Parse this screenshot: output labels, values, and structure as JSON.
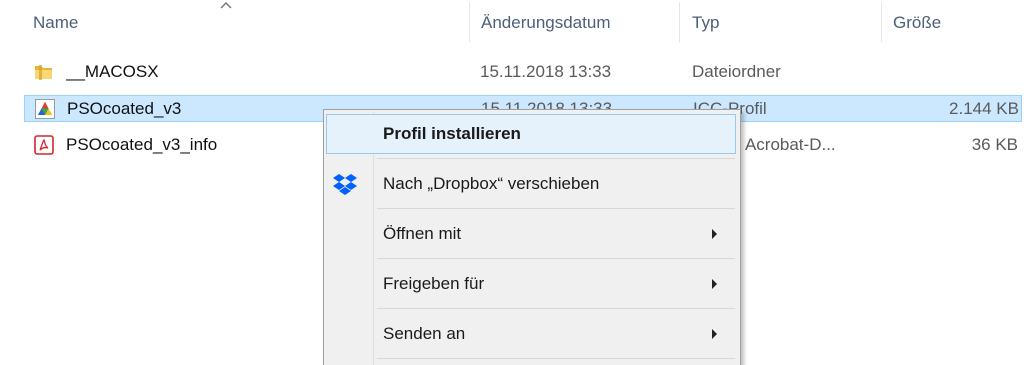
{
  "columns": {
    "name": "Name",
    "modified": "Änderungsdatum",
    "type": "Typ",
    "size": "Größe"
  },
  "files": [
    {
      "name": "__MACOSX",
      "modified": "15.11.2018 13:33",
      "type": "Dateiordner",
      "size": "",
      "icon": "folder-icon"
    },
    {
      "name": "PSOcoated_v3",
      "modified": "15.11.2018 13:33",
      "type": "ICC-Profil",
      "size": "2.144 KB",
      "icon": "icc-profile-icon",
      "selected": true
    },
    {
      "name": "PSOcoated_v3_info",
      "modified": "",
      "type": "Adobe Acrobat-D...",
      "size": "36 KB",
      "icon": "pdf-icon"
    }
  ],
  "context_menu": {
    "items": [
      {
        "label": "Profil installieren",
        "highlighted": true
      },
      {
        "label": "Nach „Dropbox“ verschieben",
        "icon": "dropbox-icon"
      },
      {
        "label": "Öffnen mit",
        "submenu": true
      },
      {
        "label": "Freigeben für",
        "submenu": true
      },
      {
        "label": "Senden an",
        "submenu": true
      }
    ]
  },
  "colors": {
    "selection_bg": "#cce8ff",
    "selection_border": "#99d1ff",
    "menu_bg": "#f0f0f0",
    "menu_highlight": "#e5f1fb",
    "header_text": "#4c607a",
    "dropbox_blue": "#0061fe"
  }
}
